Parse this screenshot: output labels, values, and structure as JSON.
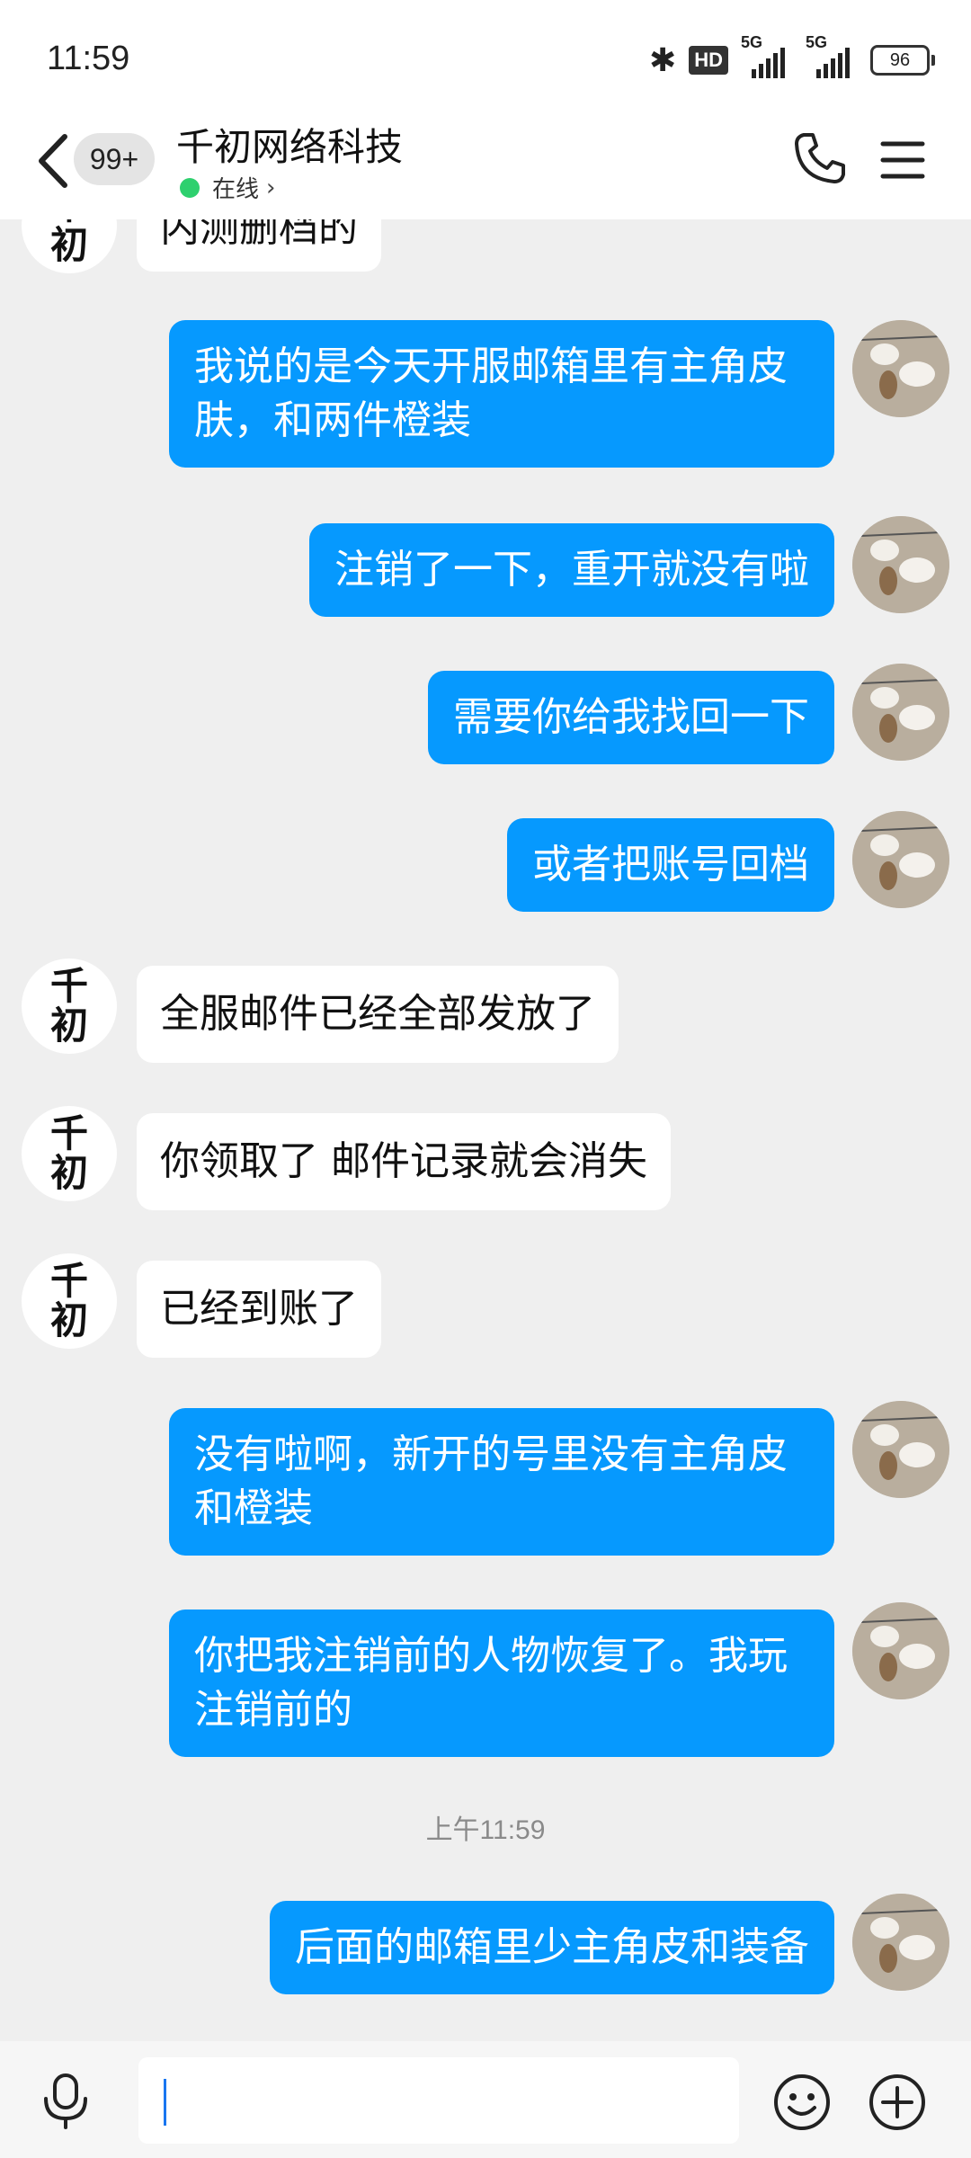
{
  "status_bar": {
    "time": "11:59",
    "hd": "HD",
    "sig1": "5G",
    "sig2": "5G",
    "battery": "96"
  },
  "header": {
    "unread": "99+",
    "title": "千初网络科技",
    "status": "在线",
    "avatar_char_top": "千",
    "avatar_char_bottom": "初"
  },
  "messages": [
    {
      "side": "left",
      "text": "内测删档的"
    },
    {
      "side": "right",
      "lines": [
        "我说的是今天开服邮箱里有主角皮",
        "肤，和两件橙装"
      ]
    },
    {
      "side": "right",
      "lines": [
        "注销了一下，重开就没有啦"
      ]
    },
    {
      "side": "right",
      "lines": [
        "需要你给我找回一下"
      ]
    },
    {
      "side": "right",
      "lines": [
        "或者把账号回档"
      ]
    },
    {
      "side": "left",
      "text": "全服邮件已经全部发放了"
    },
    {
      "side": "left",
      "text": "你领取了 邮件记录就会消失"
    },
    {
      "side": "left",
      "text": "已经到账了"
    },
    {
      "side": "right",
      "lines": [
        "没有啦啊，新开的号里没有主角皮",
        "和橙装"
      ]
    },
    {
      "side": "right",
      "lines": [
        "你把我注销前的人物恢复了。我玩",
        "注销前的"
      ]
    },
    {
      "side": "time",
      "text": "上午11:59"
    },
    {
      "side": "right",
      "lines": [
        "后面的邮箱里少主角皮和装备"
      ]
    }
  ],
  "colors": {
    "bubble_right": "#0699fe",
    "bubble_left": "#ffffff",
    "background": "#efefef",
    "online_dot": "#2ed06e"
  },
  "icons": [
    "back-icon",
    "phone-icon",
    "menu-icon",
    "microphone-icon",
    "emoji-icon",
    "plus-icon",
    "bluetooth-icon"
  ]
}
